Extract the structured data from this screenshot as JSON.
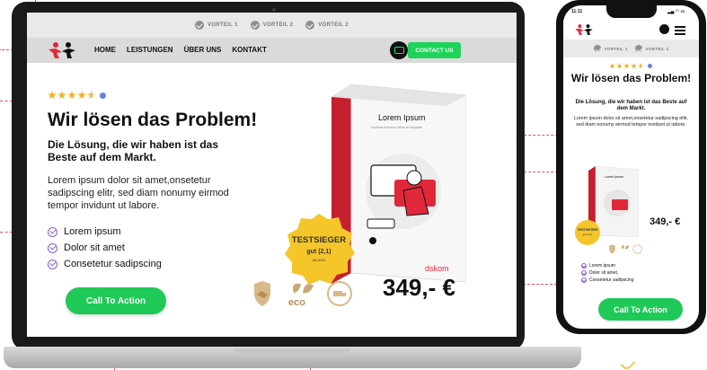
{
  "laptop": {
    "vorteile": [
      "VORTEIL 1",
      "VORTEIL 2",
      "VORTEIL 2"
    ],
    "nav": [
      "HOME",
      "LEISTUNGEN",
      "ÜBER UNS",
      "KONTAKT"
    ],
    "contact_label": "CONTACT US",
    "rating_stars": 4.5,
    "title": "Wir lösen das Problem!",
    "subtitle": "Die Lösung, die wir haben ist das Beste auf dem Markt.",
    "body": "Lorem ipsum dolor sit amet,onsetetur sadipscing elitr, sed diam nonumy eirmod tempor invidunt ut labore.",
    "bullets": [
      "Lorem ipsum",
      "Dolor sit amet",
      "Consetetur sadipscing"
    ],
    "cta": "Call To Action",
    "product": {
      "name": "Lorem Ipsum",
      "tagline": "Vivamus euismod, tellus at vulputate",
      "brand": "dskom"
    },
    "seal": {
      "title": "TESTSIEGER",
      "grade": "gut (2,1)",
      "date": "06.2024"
    },
    "price": "349,- €",
    "trust_icons": [
      "handshake-icon",
      "eco-icon",
      "free-shipping-icon"
    ]
  },
  "phone": {
    "time": "11:11",
    "vorteile": [
      "VORTEIL 1",
      "VORTEIL 2"
    ],
    "title": "Wir lösen das Problem!",
    "subtitle": "Die Lösung, die wir haben ist das Beste auf dem Markt.",
    "body": "Lorem ipsum dolor sit amet,onsetetur sadipscing elitr, sed diam nonumy eirmod tempor invidunt ut labore.",
    "bullets": [
      "Lorem ipsum",
      "Dolor sit amet,",
      "Consetetur sadipscing"
    ],
    "price": "349,- €",
    "cta": "Call To Action",
    "seal": {
      "title": "TESTSIEGER",
      "grade": "gut (2,1)"
    },
    "product": {
      "name": "Lorem Ipsum"
    }
  },
  "colors": {
    "accent_green": "#1fc957",
    "brand_red": "#e0283a",
    "annotation_red": "#e0506a",
    "star_gold": "#f2b01e",
    "check_purple": "#8a5cd0"
  }
}
